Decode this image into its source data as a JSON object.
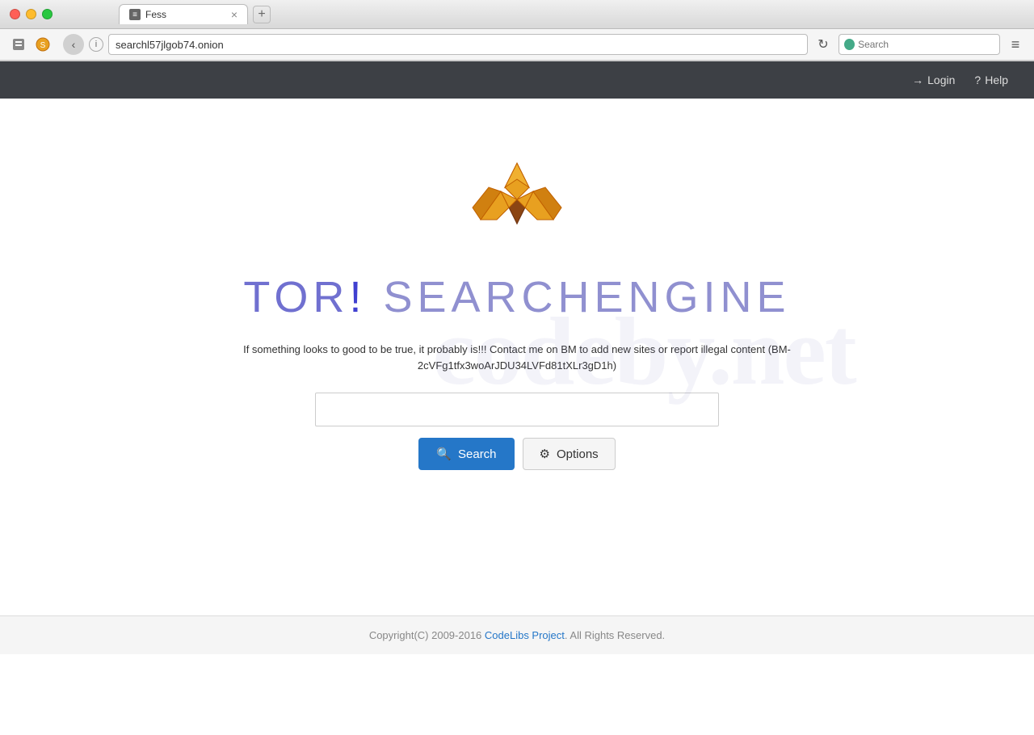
{
  "browser": {
    "tab_label": "Fess",
    "tab_close": "×",
    "new_tab": "+",
    "address": "searchl57jlgob74.onion",
    "search_placeholder": "Search",
    "back_btn": "‹",
    "reload_btn": "↻",
    "menu_btn": "≡"
  },
  "navbar": {
    "login_label": "Login",
    "help_label": "Help",
    "login_icon": "→",
    "help_icon": "?"
  },
  "main": {
    "watermark": "codeby.net",
    "title_tor": "TOR",
    "title_excl": "!",
    "title_search": "SEARCHENGINE",
    "disclaimer": "If something looks to good to be true, it probably is!!! Contact me on BM to add new sites or report illegal content (BM-2cVFg1tfx3woArJDU34LVFd81tXLr3gD1h)",
    "search_placeholder": "",
    "search_btn": "Search",
    "options_btn": "Options"
  },
  "footer": {
    "copyright_plain": "Copyright(C) 2009-2016 ",
    "copyright_link": "CodeLibs Project",
    "copyright_end": ". All Rights Reserved."
  }
}
